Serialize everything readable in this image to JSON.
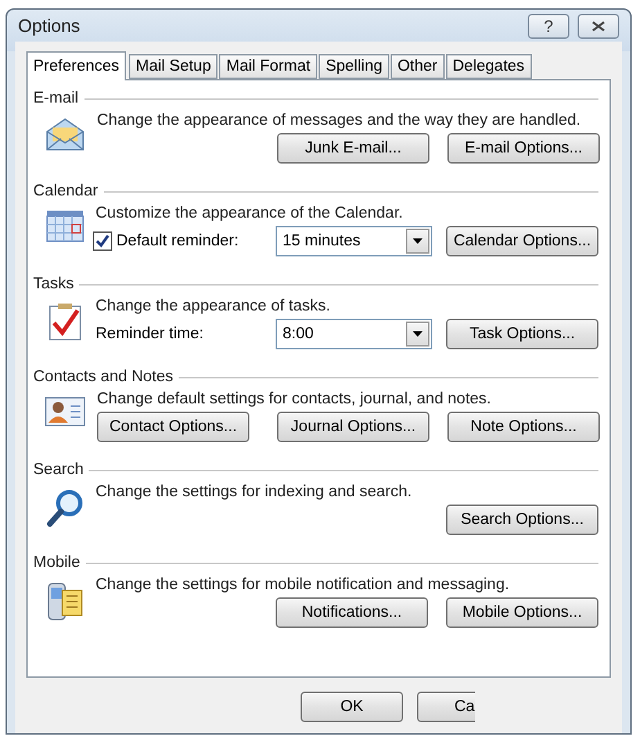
{
  "window": {
    "title": "Options",
    "help": "?"
  },
  "tabs": [
    {
      "label": "Preferences",
      "selected": true
    },
    {
      "label": "Mail Setup",
      "selected": false
    },
    {
      "label": "Mail Format",
      "selected": false
    },
    {
      "label": "Spelling",
      "selected": false
    },
    {
      "label": "Other",
      "selected": false
    },
    {
      "label": "Delegates",
      "selected": false
    }
  ],
  "sections": [
    {
      "title": "E-mail",
      "description": "Change the appearance of messages and the way they are handled.",
      "row": {
        "kind": "buttons",
        "buttons": [
          "Junk E-mail...",
          "E-mail Options..."
        ]
      }
    },
    {
      "title": "Calendar",
      "description": "Customize the appearance of the Calendar.",
      "row": {
        "kind": "checkbox-select",
        "label": "Default reminder:",
        "checked": true,
        "value": "15 minutes",
        "button": "Calendar Options..."
      }
    },
    {
      "title": "Tasks",
      "description": "Change the appearance of tasks.",
      "row": {
        "kind": "select",
        "label": "Reminder time:",
        "value": "8:00",
        "button": "Task Options..."
      }
    },
    {
      "title": "Contacts and Notes",
      "description": "Change default settings for contacts, journal, and notes.",
      "row": {
        "kind": "buttons",
        "buttons": [
          "Contact Options...",
          "Journal Options...",
          "Note Options..."
        ]
      }
    },
    {
      "title": "Search",
      "description": "Change the settings for indexing and search.",
      "row": {
        "kind": "buttons",
        "buttons": [
          "Search Options..."
        ]
      }
    },
    {
      "title": "Mobile",
      "description": "Change the settings for mobile notification and messaging.",
      "row": {
        "kind": "buttons",
        "buttons": [
          "Notifications...",
          "Mobile Options..."
        ]
      }
    }
  ],
  "footer": {
    "buttons": [
      "OK",
      "Ca"
    ]
  }
}
